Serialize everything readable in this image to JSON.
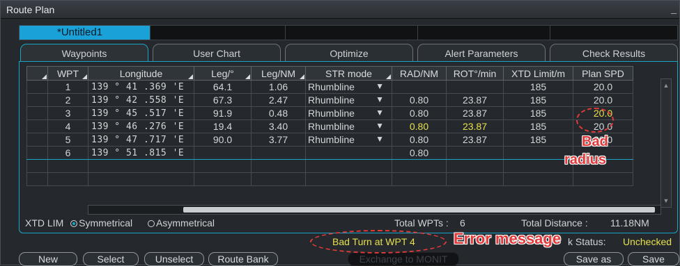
{
  "window": {
    "title": "Route Plan",
    "minimize": "_"
  },
  "file_tab": "*Untitled1",
  "tabs": [
    "Waypoints",
    "User Chart",
    "Optimize",
    "Alert Parameters",
    "Check Results"
  ],
  "table": {
    "columns": [
      "WPT",
      "Longitude",
      "Leg/°",
      "Leg/NM",
      "STR mode",
      "RAD/NM",
      "ROT°/min",
      "XTD Limit/m",
      "Plan SPD"
    ],
    "rows": [
      {
        "wpt": "1",
        "lon": "139 ° 41 .369 'E",
        "leg_deg": "64.1",
        "leg_nm": "1.06",
        "str": "Rhumbline",
        "rad": "",
        "rot": "",
        "xtd": "185",
        "spd": "20.0"
      },
      {
        "wpt": "2",
        "lon": "139 ° 42 .558 'E",
        "leg_deg": "67.3",
        "leg_nm": "2.47",
        "str": "Rhumbline",
        "rad": "0.80",
        "rot": "23.87",
        "xtd": "185",
        "spd": "20.0"
      },
      {
        "wpt": "3",
        "lon": "139 ° 45 .517 'E",
        "leg_deg": "91.9",
        "leg_nm": "0.48",
        "str": "Rhumbline",
        "rad": "0.80",
        "rot": "23.87",
        "xtd": "185",
        "spd": "20.0"
      },
      {
        "wpt": "4",
        "lon": "139 ° 46 .276 'E",
        "leg_deg": "19.4",
        "leg_nm": "3.40",
        "str": "Rhumbline",
        "rad": "0.80",
        "rot": "23.87",
        "xtd": "185",
        "spd": "20.0"
      },
      {
        "wpt": "5",
        "lon": "139 ° 47 .717 'E",
        "leg_deg": "90.0",
        "leg_nm": "3.77",
        "str": "Rhumbline",
        "rad": "0.80",
        "rot": "23.87",
        "xtd": "185",
        "spd": "20.0"
      },
      {
        "wpt": "6",
        "lon": "139 ° 51 .815 'E",
        "leg_deg": "",
        "leg_nm": "",
        "str": "",
        "rad": "0.80",
        "rot": "",
        "xtd": "",
        "spd": ""
      }
    ],
    "str_arrow": "▼"
  },
  "xtd": {
    "label": "XTD LIM",
    "symmetrical": "Symmetrical",
    "asymmetrical": "Asymmetrical"
  },
  "totals": {
    "wpts_label": "Total WPTs :",
    "wpts_value": "6",
    "distance_label": "Total Distance :",
    "distance_value": "11.18NM"
  },
  "status": {
    "error": "Bad Turn at WPT 4",
    "check_label": "k Status:",
    "check_value": "Unchecked"
  },
  "buttons": {
    "new": "New",
    "select": "Select",
    "unselect": "Unselect",
    "route_bank": "Route Bank",
    "exchange": "Exchange to MONIT",
    "save_as": "Save as",
    "save": "Save"
  },
  "annotations": {
    "bad": "Bad",
    "radius": "radius",
    "error_message": "Error message"
  },
  "colors": {
    "accent": "#18a6c8",
    "warning": "#e7e04a",
    "annotation": "#e23a3a"
  }
}
